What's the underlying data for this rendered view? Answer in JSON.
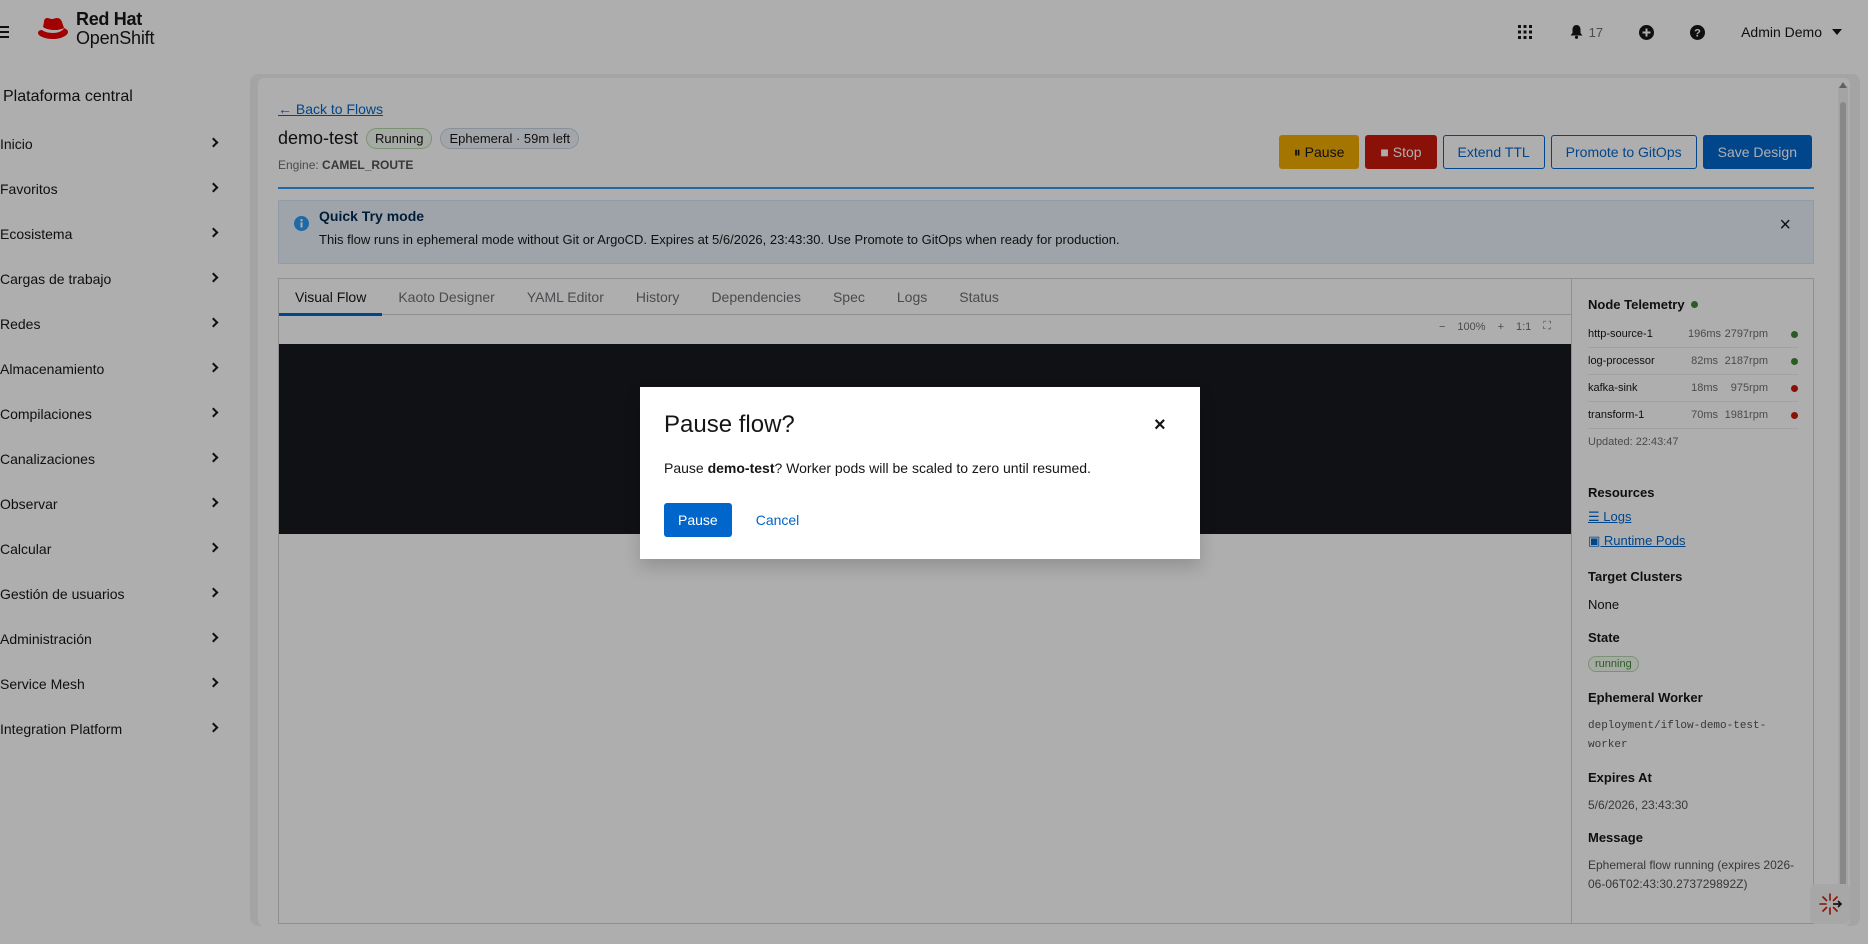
{
  "masthead": {
    "brand_line1": "Red Hat",
    "brand_line2": "OpenShift",
    "notifications_count": "17",
    "user_name": "Admin Demo",
    "icons": [
      "menu-icon",
      "grid-apps-icon",
      "bell-icon",
      "plus-circle-icon",
      "help-icon",
      "caret-down-icon"
    ]
  },
  "sidebar": {
    "perspective": "Plataforma central",
    "items": [
      {
        "label": "Inicio"
      },
      {
        "label": "Favoritos"
      },
      {
        "label": "Ecosistema"
      },
      {
        "label": "Cargas de trabajo"
      },
      {
        "label": "Redes"
      },
      {
        "label": "Almacenamiento"
      },
      {
        "label": "Compilaciones"
      },
      {
        "label": "Canalizaciones"
      },
      {
        "label": "Observar"
      },
      {
        "label": "Calcular"
      },
      {
        "label": "Gestión de usuarios"
      },
      {
        "label": "Administración"
      },
      {
        "label": "Service Mesh"
      },
      {
        "label": "Integration Platform"
      }
    ]
  },
  "flow": {
    "back_link": "← Back to Flows",
    "name": "demo-test",
    "status_badge": "Running",
    "ephemeral_badge": "Ephemeral · 59m left",
    "engine_label": "Engine:",
    "engine_value": "CAMEL_ROUTE"
  },
  "actions": {
    "pause": "⏸ Pause",
    "stop": "■ Stop",
    "extend_ttl": "Extend TTL",
    "promote": "Promote to GitOps",
    "save": "Save Design"
  },
  "alert": {
    "title": "Quick Try mode",
    "body": "This flow runs in ephemeral mode without Git or ArgoCD. Expires at 5/6/2026, 23:43:30. Use Promote to GitOps when ready for production.",
    "close": "×"
  },
  "tabs": [
    {
      "label": "Visual Flow",
      "active": true
    },
    {
      "label": "Kaoto Designer"
    },
    {
      "label": "YAML Editor"
    },
    {
      "label": "History"
    },
    {
      "label": "Dependencies"
    },
    {
      "label": "Spec"
    },
    {
      "label": "Logs"
    },
    {
      "label": "Status"
    }
  ],
  "zoom": {
    "minus": "−",
    "level": "100%",
    "plus": "+",
    "reset": "1:1",
    "fullscreen": "⛶"
  },
  "telemetry": {
    "title": "Node Telemetry",
    "rows": [
      {
        "name": "http-source-1",
        "latency": "196ms",
        "rate": "2797rpm",
        "status_color": "#3e8635"
      },
      {
        "name": "log-processor",
        "latency": "82ms",
        "rate": "2187rpm",
        "status_color": "#3e8635"
      },
      {
        "name": "kafka-sink",
        "latency": "18ms",
        "rate": "975rpm",
        "status_color": "#c9190b"
      },
      {
        "name": "transform-1",
        "latency": "70ms",
        "rate": "1981rpm",
        "status_color": "#c9190b"
      }
    ],
    "updated": "Updated: 22:43:47"
  },
  "resources": {
    "title": "Resources",
    "logs_link": "☰ Logs",
    "pods_link": "▣ Runtime Pods"
  },
  "details": {
    "target_clusters_title": "Target Clusters",
    "target_clusters_value": "None",
    "state_title": "State",
    "state_value": "running",
    "worker_title": "Ephemeral Worker",
    "worker_value": "deployment/iflow-demo-test-worker",
    "expires_title": "Expires At",
    "expires_value": "5/6/2026, 23:43:30",
    "message_title": "Message",
    "message_value": "Ephemeral flow running (expires 2026-06-06T02:43:30.273729892Z)"
  },
  "modal": {
    "title": "Pause flow?",
    "body_prefix": "Pause ",
    "body_name": "demo-test",
    "body_suffix": "? Worker pods will be scaled to zero until resumed.",
    "confirm": "Pause",
    "cancel": "Cancel",
    "close": "×"
  },
  "colors": {
    "primary": "#0066cc",
    "warning": "#f0ab00",
    "danger": "#c9190b",
    "success": "#3e8635",
    "brand_red": "#ee0000"
  }
}
